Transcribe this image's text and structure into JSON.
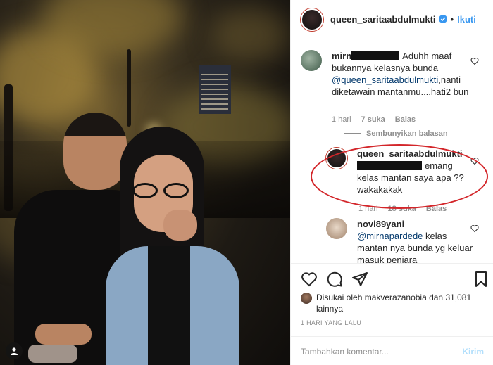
{
  "header": {
    "username": "queen_saritaabdulmukti",
    "separator": "•",
    "follow_label": "Ikuti"
  },
  "comments": [
    {
      "username": "mirn",
      "text": "Aduhh maaf bukannya kelasnya bunda",
      "mention": "@queen_saritaabdulmukti",
      "text_after": ",nanti diketawain mantanmu....hati2 bun",
      "time": "1 hari",
      "likes": "7 suka",
      "reply": "Balas"
    },
    {
      "username": "queen_saritaabdulmukti",
      "text": "emang kelas mantan saya apa ?? wakakakak",
      "time": "1 hari",
      "likes": "18 suka",
      "reply": "Balas"
    },
    {
      "username": "novi89yani",
      "mention": "@mirnapardede",
      "text": "kelas mantan nya bunda yg keluar masuk penjara"
    }
  ],
  "hide_replies": "Sembunyikan balasan",
  "likes": {
    "text": "Disukai oleh makverazanobia dan 31,081 lainnya"
  },
  "timestamp": "1 HARI YANG LALU",
  "add_comment": {
    "placeholder": "Tambahkan komentar...",
    "post_label": "Kirim"
  },
  "colors": {
    "link": "#3897f0",
    "mention": "#00376b",
    "highlight": "#d3262a",
    "muted": "#8e8e8e"
  }
}
